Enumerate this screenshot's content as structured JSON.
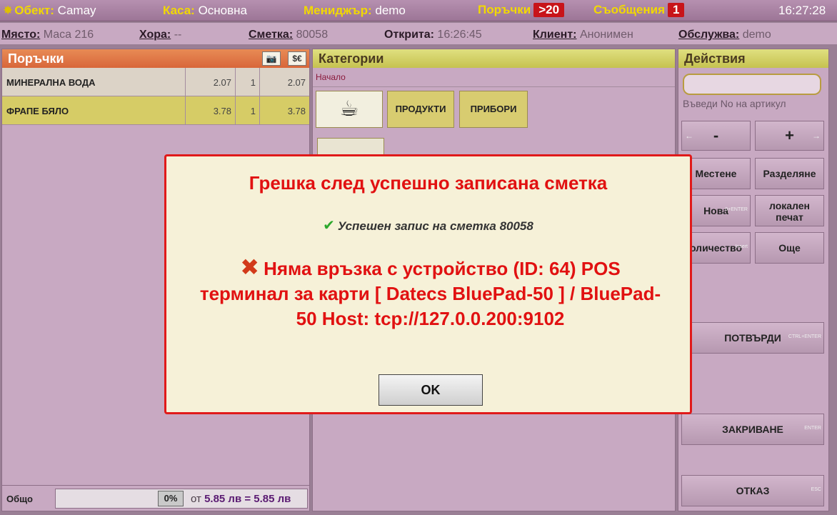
{
  "topbar": {
    "object_label": "Обект:",
    "object_value": "Camay",
    "register_label": "Каса:",
    "register_value": "Основна",
    "manager_label": "Мениджър:",
    "manager_value": "demo",
    "orders_label": "Поръчки",
    "orders_badge": ">20",
    "messages_label": "Съобщения",
    "messages_badge": "1",
    "clock": "16:27:28"
  },
  "infobar": {
    "place_label": "Място:",
    "place_value": "Маса 216",
    "people_label": "Хора:",
    "people_value": "--",
    "bill_label": "Сметка:",
    "bill_value": "80058",
    "opened_label": "Открита:",
    "opened_value": "16:26:45",
    "client_label": "Клиент:",
    "client_value": "Анонимен",
    "served_label": "Обслужва:",
    "served_value": "demo"
  },
  "orders": {
    "title": "Поръчки",
    "items": [
      {
        "name": "МИНЕРАЛНА ВОДА",
        "price": "2.07",
        "qty": "1",
        "total": "2.07"
      },
      {
        "name": "ФРАПЕ БЯЛО",
        "price": "3.78",
        "qty": "1",
        "total": "3.78"
      }
    ],
    "total_label": "Общо",
    "discount": "0%",
    "sum_prefix": "от",
    "sum_text": "5.85 лв = 5.85 лв"
  },
  "categories": {
    "title": "Категории",
    "breadcrumb": "Начало",
    "buttons": [
      {
        "label": "ПРОДУКТИ"
      },
      {
        "label": "ПРИБОРИ"
      }
    ]
  },
  "actions": {
    "title": "Действия",
    "article_placeholder": "Въведи No на артикул",
    "minus": "-",
    "plus": "+",
    "move": "Местене",
    "split": "Разделяне",
    "new": "Нова",
    "new_hint": "0+ENTER",
    "local_print": "локален печат",
    "quantity": "оличество",
    "quantity_hint": "Insert",
    "more": "Още",
    "confirm": "ПОТВЪРДИ",
    "confirm_hint": "CTRL+ENTER",
    "close": "ЗАКРИВАНЕ",
    "close_hint": "ENTER",
    "cancel": "ОТКАЗ",
    "cancel_hint": "ESC"
  },
  "modal": {
    "title": "Грешка след успешно записана сметка",
    "success": "Успешен запис на сметка 80058",
    "error": "Няма връзка с устройство (ID: 64) POS терминал за карти [ Datecs BluePad-50 ] / BluePad-50 Host: tcp://127.0.0.200:9102",
    "ok": "OK"
  },
  "colors": {
    "modal_border": "#e01a1a",
    "error_text": "#e11111",
    "orders_header": "#d8663a"
  }
}
